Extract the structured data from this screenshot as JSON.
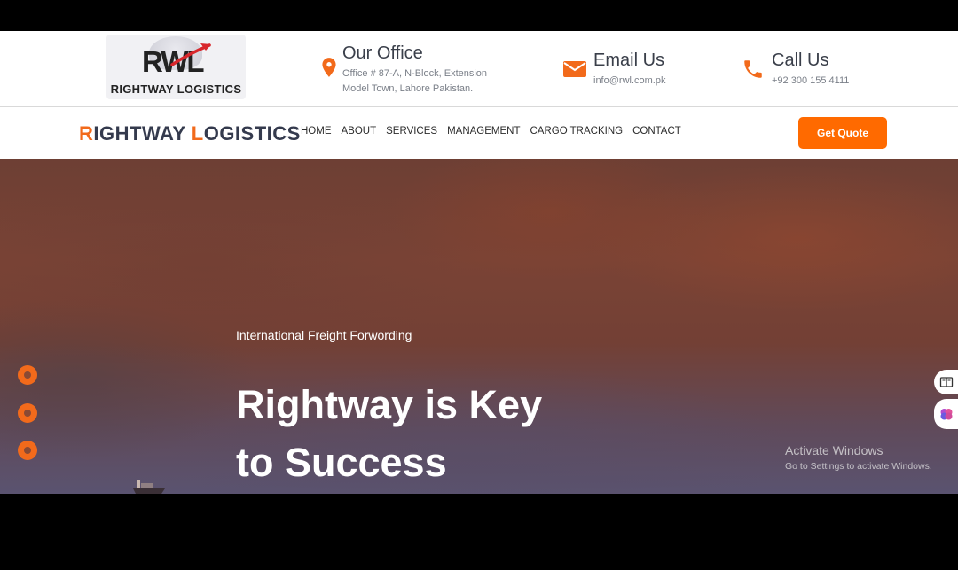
{
  "logo": {
    "mark": "RWL",
    "text_main": "RIGHTWAY",
    "text_rest": " LOGISTICS"
  },
  "contact": {
    "office": {
      "icon": "location-pin-icon",
      "title": "Our Office",
      "line1": "Office # 87-A, N-Block, Extension",
      "line2": "Model Town, Lahore Pakistan."
    },
    "email": {
      "icon": "envelope-icon",
      "title": "Email Us",
      "value": "info@rwl.com.pk"
    },
    "call": {
      "icon": "phone-icon",
      "title": "Call Us",
      "value": "+92 300 155 4111"
    }
  },
  "nav": {
    "brand_r": "R",
    "brand_ightway": "IGHTWAY ",
    "brand_l": "L",
    "brand_ogistics": "OGISTICS",
    "items": [
      "HOME",
      "ABOUT",
      "SERVICES",
      "MANAGEMENT",
      "CARGO TRACKING",
      "CONTACT"
    ],
    "quote_button": "Get Quote"
  },
  "hero": {
    "subtitle": "International Freight Forwording",
    "title_line1": "Rightway is Key",
    "title_line2": "to Success",
    "slider_dots": 3
  },
  "watermark": {
    "title": "Activate Windows",
    "subtitle": "Go to Settings to activate Windows."
  },
  "colors": {
    "accent": "#f26a1b",
    "button": "#ff6a00",
    "brand_text": "#343a4d"
  }
}
